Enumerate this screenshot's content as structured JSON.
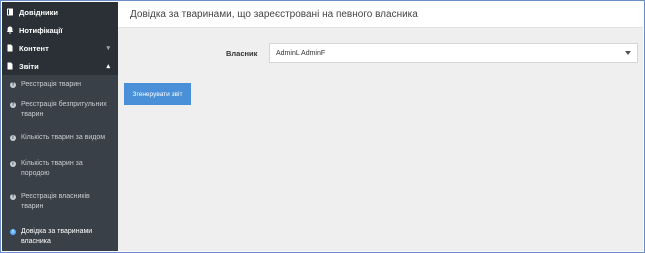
{
  "sidebar": {
    "items": [
      {
        "label": "Довідники",
        "icon": "book-icon"
      },
      {
        "label": "Нотифікації",
        "icon": "bell-icon"
      },
      {
        "label": "Контент",
        "icon": "file-icon",
        "chevron": "down"
      },
      {
        "label": "Звіти",
        "icon": "file-icon",
        "chevron": "up"
      }
    ],
    "reports": [
      "Реєстрація тварин",
      "Реєстрація безпритульних тварин",
      "Кількість тварин за видом",
      "Кількість тварин за породою",
      "Реєстрація власників тварин",
      "Довідка за тваринами власника"
    ]
  },
  "main": {
    "title": "Довідка за тваринами, що зареєстровані на певного власника",
    "owner_label": "Власник",
    "owner_value": "AdminL AdminF",
    "generate_button": "Згенерувати звіт"
  },
  "colors": {
    "sidebar_bg": "#2a3036",
    "submenu_bg": "#3a4047",
    "button": "#4a90d9",
    "active_dot": "#5bb0ff"
  }
}
